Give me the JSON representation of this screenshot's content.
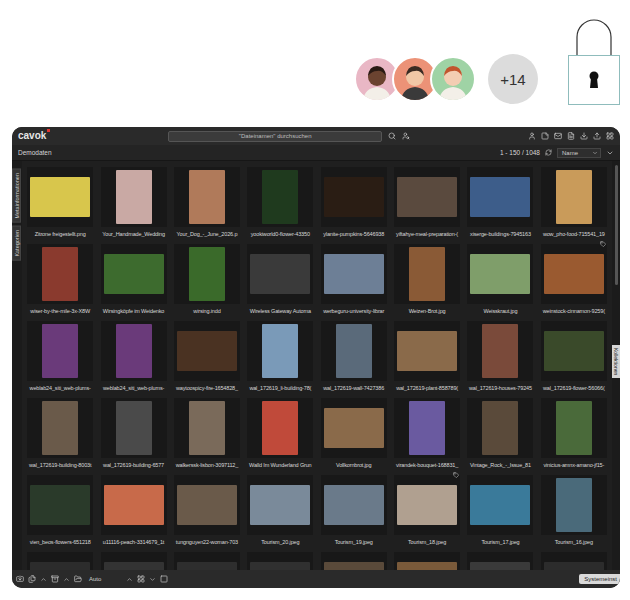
{
  "hero": {
    "collaborators": [
      {
        "color": "#e9b7c5"
      },
      {
        "color": "#ec9277"
      },
      {
        "color": "#9fd3a5"
      }
    ],
    "more": "+14",
    "lock": {
      "locked": false
    }
  },
  "app": {
    "logo": "cavok",
    "search": {
      "placeholder": "\"Dateinamen\" durchsuchen"
    },
    "breadcrumb": "Demodaten",
    "range": "1 - 150 / 1048",
    "sort": {
      "label": "Name"
    },
    "left_tabs": [
      {
        "label": "Metainformationen",
        "selected": false
      },
      {
        "label": "Kategorien",
        "selected": false
      }
    ],
    "right_tabs": [
      {
        "label": "Kollektionen",
        "selected": false
      }
    ],
    "thumbnails": [
      {
        "name": "Zitrone freigestellt.png",
        "kind": "landscape",
        "color": "#d8c64c",
        "tagged": false
      },
      {
        "name": "Your_Handmade_Wedding",
        "kind": "portrait",
        "color": "#c9a9a4",
        "tagged": false
      },
      {
        "name": "Your_Dog_-_June_2026.p",
        "kind": "portrait",
        "color": "#b07a5a",
        "tagged": false
      },
      {
        "name": "yookiworld0-flower-43350",
        "kind": "portrait",
        "color": "#1f3a1e",
        "tagged": false
      },
      {
        "name": "ylanite-pumpkins-5646938",
        "kind": "landscape",
        "color": "#2a1d14",
        "tagged": false
      },
      {
        "name": "yiftahye-meal-preparation-(",
        "kind": "landscape",
        "color": "#5a4a3e",
        "tagged": false
      },
      {
        "name": "xiserge-buildings-7945163",
        "kind": "landscape",
        "color": "#3d5d8a",
        "tagged": false
      },
      {
        "name": "wow_pho-food-715541_19",
        "kind": "portrait",
        "color": "#c99b5a",
        "tagged": false
      },
      {
        "name": "wiser-by-the-mile-3x-X8W",
        "kind": "portrait",
        "color": "#8a3a2e",
        "tagged": false
      },
      {
        "name": "Wirsingköpfe im Weidenko",
        "kind": "landscape",
        "color": "#3d6b2e",
        "tagged": false
      },
      {
        "name": "wirsing.indd",
        "kind": "portrait",
        "color": "#3a6a2a",
        "tagged": false
      },
      {
        "name": "Wireless Gateway Automa",
        "kind": "landscape",
        "color": "#3a3a3a",
        "tagged": false
      },
      {
        "name": "werbeguru-university-librar",
        "kind": "landscape",
        "color": "#6d7f96",
        "tagged": false
      },
      {
        "name": "Weizen-Brot.jpg",
        "kind": "portrait",
        "color": "#8a5a36",
        "tagged": false
      },
      {
        "name": "Weisskraut.jpg",
        "kind": "landscape",
        "color": "#7f9e6a",
        "tagged": false
      },
      {
        "name": "weinstock-cinnamon-9259(",
        "kind": "landscape",
        "color": "#9a5a30",
        "tagged": true
      },
      {
        "name": "weblab24_siti_web-plums-",
        "kind": "portrait",
        "color": "#6a3a7a",
        "tagged": false
      },
      {
        "name": "weblab24_siti_web-plums-",
        "kind": "portrait",
        "color": "#6a3a7a",
        "tagged": false
      },
      {
        "name": "waytoospicy-fire-1654828_",
        "kind": "landscape",
        "color": "#4a3222",
        "tagged": false
      },
      {
        "name": "wal_172619_li-building-78(",
        "kind": "portrait",
        "color": "#7a9ab8",
        "tagged": false
      },
      {
        "name": "wal_172619-wall-7427386",
        "kind": "portrait",
        "color": "#5a6a7a",
        "tagged": false
      },
      {
        "name": "wal_172619-plant-858789(",
        "kind": "landscape",
        "color": "#8a6a4a",
        "tagged": false
      },
      {
        "name": "wal_172619-houses-79245",
        "kind": "portrait",
        "color": "#7a4a3a",
        "tagged": false
      },
      {
        "name": "wal_172619-flower-56066(",
        "kind": "landscape",
        "color": "#3a4a2a",
        "tagged": false
      },
      {
        "name": "wal_172619-building-8003t",
        "kind": "portrait",
        "color": "#6a5a4a",
        "tagged": false
      },
      {
        "name": "wal_172619-building-6577",
        "kind": "portrait",
        "color": "#4a4a4a",
        "tagged": false
      },
      {
        "name": "walkerssk-lisbon-3097112_",
        "kind": "portrait",
        "color": "#7a6a5a",
        "tagged": false
      },
      {
        "name": "Walld Im Wunderland Grun",
        "kind": "portrait",
        "color": "#c04a3a",
        "tagged": false
      },
      {
        "name": "Vollkornbrot.jpg",
        "kind": "landscape",
        "color": "#8a6a4a",
        "tagged": false
      },
      {
        "name": "virandek-bouquet-168831_",
        "kind": "portrait",
        "color": "#6a5aa0",
        "tagged": false
      },
      {
        "name": "Vintage_Rock_-_Issue_81",
        "kind": "portrait",
        "color": "#5a4a3a",
        "tagged": false
      },
      {
        "name": "vinicius-amnx-amano-jf15-",
        "kind": "portrait",
        "color": "#4a6a3a",
        "tagged": false
      },
      {
        "name": "vien_beos-flowers-651218",
        "kind": "landscape",
        "color": "#2a3a2a",
        "tagged": false
      },
      {
        "name": "u11116-peach-3314679_1t",
        "kind": "landscape",
        "color": "#c86a4a",
        "tagged": false
      },
      {
        "name": "tungnguyen22-woman-703",
        "kind": "landscape",
        "color": "#6a5a4a",
        "tagged": false
      },
      {
        "name": "Tourism_20.jpeg",
        "kind": "landscape",
        "color": "#7a8a9a",
        "tagged": false
      },
      {
        "name": "Tourism_19.jpeg",
        "kind": "landscape",
        "color": "#6a7a8a",
        "tagged": false
      },
      {
        "name": "Tourism_18.jpeg",
        "kind": "landscape",
        "color": "#b0a090",
        "tagged": true
      },
      {
        "name": "Tourism_17.jpeg",
        "kind": "landscape",
        "color": "#3a7a9a",
        "tagged": false
      },
      {
        "name": "Tourism_16.jpeg",
        "kind": "portrait",
        "color": "#4a6a7a",
        "tagged": false
      }
    ],
    "partial_thumbnails": [
      {
        "color": "#2c2c2c"
      },
      {
        "color": "#333333"
      },
      {
        "color": "#2e2e2e"
      },
      {
        "color": "#303030"
      },
      {
        "color": "#5a4a3a"
      },
      {
        "color": "#7a5a3a"
      },
      {
        "color": "#3a3a3a"
      },
      {
        "color": "#2c2c2c"
      }
    ],
    "status_bar": {
      "zoom": "Auto",
      "settings_button": "Systemeinst"
    }
  }
}
